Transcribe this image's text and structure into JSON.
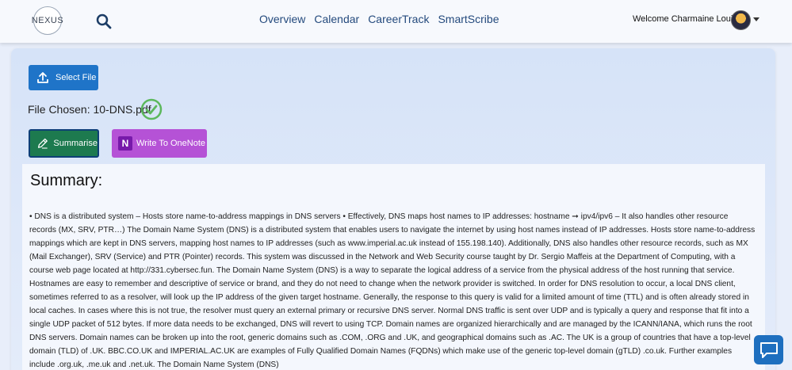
{
  "navbar": {
    "logo_text": "NEXUS",
    "links": [
      "Overview",
      "Calendar",
      "CareerTrack",
      "SmartScribe"
    ],
    "welcome": "Welcome Charmaine Louie!"
  },
  "upload": {
    "select_label": "Select File",
    "file_chosen": "File Chosen: 10-DNS.pdf"
  },
  "actions": {
    "summarise_label": "Summarise",
    "onenote_label": "Write To OneNote"
  },
  "summary": {
    "title": "Summary:",
    "text": "• DNS is a distributed system – Hosts store name-to-address mappings in DNS servers • Effectively, DNS maps host names to IP addresses: hostname ➞ ipv4/ipv6 – It also handles other resource records (MX, SRV, PTR…) The Domain Name System (DNS) is a distributed system that enables users to navigate the internet by using host names instead of IP addresses. Hosts store name-to-address mappings which are kept in DNS servers, mapping host names to IP addresses (such as www.imperial.ac.uk instead of 155.198.140). Additionally, DNS also handles other resource records, such as MX (Mail Exchanger), SRV (Service) and PTR (Pointer) records. This system was discussed in the Network and Web Security course taught by Dr. Sergio Maffeis at the Department of Computing, with a course web page located at http://331.cybersec.fun. The Domain Name System (DNS) is a way to separate the logical address of a service from the physical address of the host running that service. Hostnames are easy to remember and descriptive of service or brand, and they do not need to change when the network provider is switched. In order for DNS resolution to occur, a local DNS client, sometimes referred to as a resolver, will look up the IP address of the given target hostname. Generally, the response to this query is valid for a limited amount of time (TTL) and is often already stored in local caches. In cases where this is not true, the resolver must query an external primary or recursive DNS server. Normal DNS traffic is sent over UDP and is typically a query and response that fit into a single UDP packet of 512 bytes. If more data needs to be exchanged, DNS will revert to using TCP. Domain names are organized hierarchically and are managed by the ICANN/IANA, which runs the root DNS servers. Domain names can be broken up into the root, generic domains such as .COM, .ORG and .UK, and geographical domains such as .AC. The UK is a group of countries that have a top-level domain (TLD) of .UK. BBC.CO.UK and IMPERIAL.AC.UK are examples of Fully Qualified Domain Names (FQDNs) which make use of the generic top-level domain (gTLD) .co.uk. Further examples include .org.uk, .me.uk and .net.uk. The Domain Name System (DNS)"
  },
  "colors": {
    "primary_blue": "#1f74c8",
    "summarise_green": "#1d7a4f",
    "onenote_purple": "#b552d6",
    "check_green": "#5cb85c",
    "nav_link": "#244a7d"
  },
  "icons": [
    "search-icon",
    "upload-icon",
    "check-circle-icon",
    "pencil-icon",
    "onenote-icon",
    "chat-icon",
    "chevron-down-icon"
  ]
}
